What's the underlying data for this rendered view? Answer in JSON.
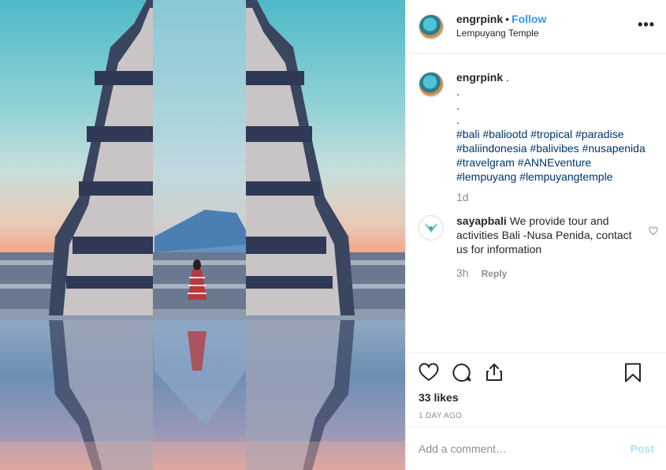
{
  "post": {
    "username": "engrpink",
    "separator": "•",
    "follow_label": "Follow",
    "location": "Lempuyang Temple",
    "more_label": "•••"
  },
  "caption": {
    "username": "engrpink",
    "lines": [
      " .",
      ".",
      ".",
      "."
    ],
    "hashtags": "#bali #baliootd #tropical #paradise #baliindonesia #balivibes #nusapenida #travelgram #ANNEventure #lempuyang #lempuyangtemple",
    "time": "1d"
  },
  "comment": {
    "username": "sayapbali",
    "text": "We provide tour and activities Bali -Nusa Penida, contact us for information",
    "time": "3h",
    "reply_label": "Reply"
  },
  "actions": {
    "likes": "33 likes",
    "time_ago": "1 DAY AGO"
  },
  "add_comment": {
    "placeholder": "Add a comment…",
    "post_label": "Post"
  }
}
